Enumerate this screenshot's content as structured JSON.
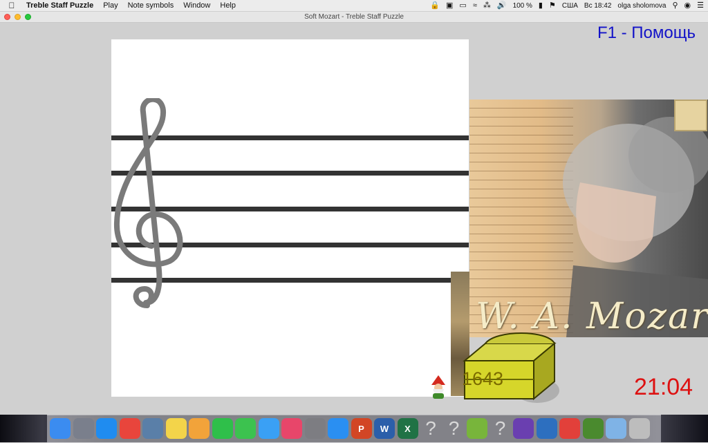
{
  "menubar": {
    "app_name": "Treble Staff Puzzle",
    "menus": [
      "Play",
      "Note symbols",
      "Window",
      "Help"
    ],
    "status": {
      "battery": "100 %",
      "input_source": "США",
      "datetime": "Вс 18:42",
      "user": "olga sholomova"
    }
  },
  "window": {
    "title": "Soft Mozart - Treble Staff Puzzle"
  },
  "game": {
    "help_hint": "F1 - Помощь",
    "portrait_caption": "W. A. Mozart",
    "chest_counter": "1643",
    "timer": "21:04"
  },
  "dock": {
    "apps": [
      {
        "name": "Finder",
        "icon": "finder-icon",
        "color": "#3b8cf0"
      },
      {
        "name": "Launchpad",
        "icon": "launchpad-icon",
        "color": "#7a7f8c"
      },
      {
        "name": "Safari",
        "icon": "safari-icon",
        "color": "#1f8cf0"
      },
      {
        "name": "Chrome",
        "icon": "chrome-icon",
        "color": "#e8453c"
      },
      {
        "name": "Preview",
        "icon": "preview-icon",
        "color": "#5a7fa8"
      },
      {
        "name": "Notes",
        "icon": "notes-icon",
        "color": "#f3d44a"
      },
      {
        "name": "Photos",
        "icon": "photos-icon",
        "color": "#f2a33a"
      },
      {
        "name": "WhatsApp",
        "icon": "whatsapp-icon",
        "color": "#2fbf4a"
      },
      {
        "name": "FaceTime",
        "icon": "facetime-icon",
        "color": "#3cc24f"
      },
      {
        "name": "Messages",
        "icon": "messages-icon",
        "color": "#3aa0f5"
      },
      {
        "name": "iTunes",
        "icon": "itunes-icon",
        "color": "#e8466a"
      },
      {
        "name": "System Preferences",
        "icon": "system-preferences-icon",
        "color": "#7d7d82"
      },
      {
        "name": "App Store",
        "icon": "app-store-icon",
        "color": "#2a8ff2"
      },
      {
        "name": "PowerPoint",
        "icon": "powerpoint-icon",
        "color": "#d24625",
        "label": "P"
      },
      {
        "name": "Word",
        "icon": "word-icon",
        "color": "#2b5faa",
        "label": "W"
      },
      {
        "name": "Excel",
        "icon": "excel-icon",
        "color": "#207245",
        "label": "X"
      },
      {
        "name": "Unknown app",
        "icon": "question-icon",
        "color": "#cccccc"
      },
      {
        "name": "Unknown app",
        "icon": "question-icon",
        "color": "#cccccc"
      },
      {
        "name": "uTorrent",
        "icon": "utorrent-icon",
        "color": "#78b53b"
      },
      {
        "name": "Unknown app",
        "icon": "question-icon",
        "color": "#cccccc"
      },
      {
        "name": "Visual Studio",
        "icon": "visual-studio-icon",
        "color": "#6a3fb0"
      },
      {
        "name": "Screen app",
        "icon": "screen-app-icon",
        "color": "#2d6fbf"
      },
      {
        "name": "AnyDesk",
        "icon": "anydesk-icon",
        "color": "#e2403a"
      },
      {
        "name": "Soft Mozart",
        "icon": "soft-mozart-icon",
        "color": "#4a8a2e"
      },
      {
        "name": "Downloads",
        "icon": "folder-icon",
        "color": "#7fb3e6"
      },
      {
        "name": "Trash",
        "icon": "trash-icon",
        "color": "#bdbdbd"
      }
    ]
  },
  "colors": {
    "help_text": "#1212c8",
    "timer": "#dd1111",
    "staff_line": "#333333",
    "clef": "#7a7a7a",
    "chest": "#d6d62a"
  }
}
